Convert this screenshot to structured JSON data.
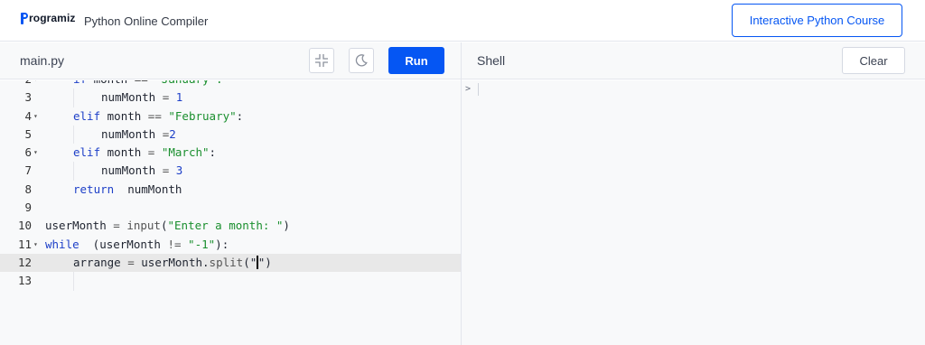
{
  "header": {
    "logo_text": "rogramiz",
    "app_title": "Python Online Compiler",
    "course_button": "Interactive Python Course"
  },
  "editor": {
    "file_name": "main.py",
    "run_label": "Run",
    "lines": [
      {
        "num": "2",
        "fold": true,
        "indent": 1,
        "tokens": [
          [
            "kw",
            "if"
          ],
          [
            "",
            "month "
          ],
          [
            "op",
            "=="
          ],
          [
            "str",
            " \"January\":"
          ]
        ]
      },
      {
        "num": "3",
        "fold": false,
        "indent": 2,
        "tokens": [
          [
            "",
            "numMonth "
          ],
          [
            "op",
            "="
          ],
          [
            "num",
            " 1"
          ]
        ]
      },
      {
        "num": "4",
        "fold": true,
        "indent": 1,
        "tokens": [
          [
            "kw",
            "elif"
          ],
          [
            "",
            "month "
          ],
          [
            "op",
            "=="
          ],
          [
            "str",
            " \"February\""
          ],
          [
            "",
            ":"
          ]
        ]
      },
      {
        "num": "5",
        "fold": false,
        "indent": 2,
        "tokens": [
          [
            "",
            "numMonth "
          ],
          [
            "op",
            "="
          ],
          [
            "num",
            "2"
          ]
        ]
      },
      {
        "num": "6",
        "fold": true,
        "indent": 1,
        "tokens": [
          [
            "kw",
            "elif"
          ],
          [
            "",
            "month "
          ],
          [
            "op",
            "="
          ],
          [
            "str",
            " \"March\""
          ],
          [
            "",
            ":"
          ]
        ]
      },
      {
        "num": "7",
        "fold": false,
        "indent": 2,
        "tokens": [
          [
            "",
            "numMonth "
          ],
          [
            "op",
            "="
          ],
          [
            "num",
            " 3"
          ]
        ]
      },
      {
        "num": "8",
        "fold": false,
        "indent": 1,
        "tokens": [
          [
            "kw",
            "return"
          ],
          [
            "",
            " numMonth"
          ]
        ]
      },
      {
        "num": "9",
        "fold": false,
        "indent": 0,
        "tokens": []
      },
      {
        "num": "10",
        "fold": false,
        "indent": 0,
        "tokens": [
          [
            "",
            "userMonth "
          ],
          [
            "op",
            "="
          ],
          [
            "fn",
            " input"
          ],
          [
            "",
            "("
          ],
          [
            "str",
            "\"Enter a month: \""
          ],
          [
            "",
            ")"
          ]
        ]
      },
      {
        "num": "11",
        "fold": true,
        "indent": 0,
        "tokens": [
          [
            "kw",
            "while"
          ],
          [
            "",
            " (userMonth "
          ],
          [
            "op",
            "!="
          ],
          [
            "str",
            " \"-1\""
          ],
          [
            "",
            "):"
          ]
        ]
      },
      {
        "num": "12",
        "fold": false,
        "indent": 1,
        "active": true,
        "tokens": [
          [
            "",
            "arrange "
          ],
          [
            "op",
            "="
          ],
          [
            "",
            " userMonth."
          ],
          [
            "fn",
            "split"
          ],
          [
            "",
            "(\""
          ],
          [
            "caret",
            ""
          ],
          [
            "",
            "\")"
          ]
        ]
      },
      {
        "num": "13",
        "fold": false,
        "indent": 1,
        "tokens": []
      }
    ]
  },
  "shell": {
    "title": "Shell",
    "clear_label": "Clear",
    "prompt": ">"
  },
  "colors": {
    "accent": "#0556f3",
    "keyword": "#1e40c8",
    "string": "#1a8f2e"
  },
  "icons": [
    "minimize-icon",
    "dark-mode-icon",
    "fold-arrow-icon"
  ]
}
